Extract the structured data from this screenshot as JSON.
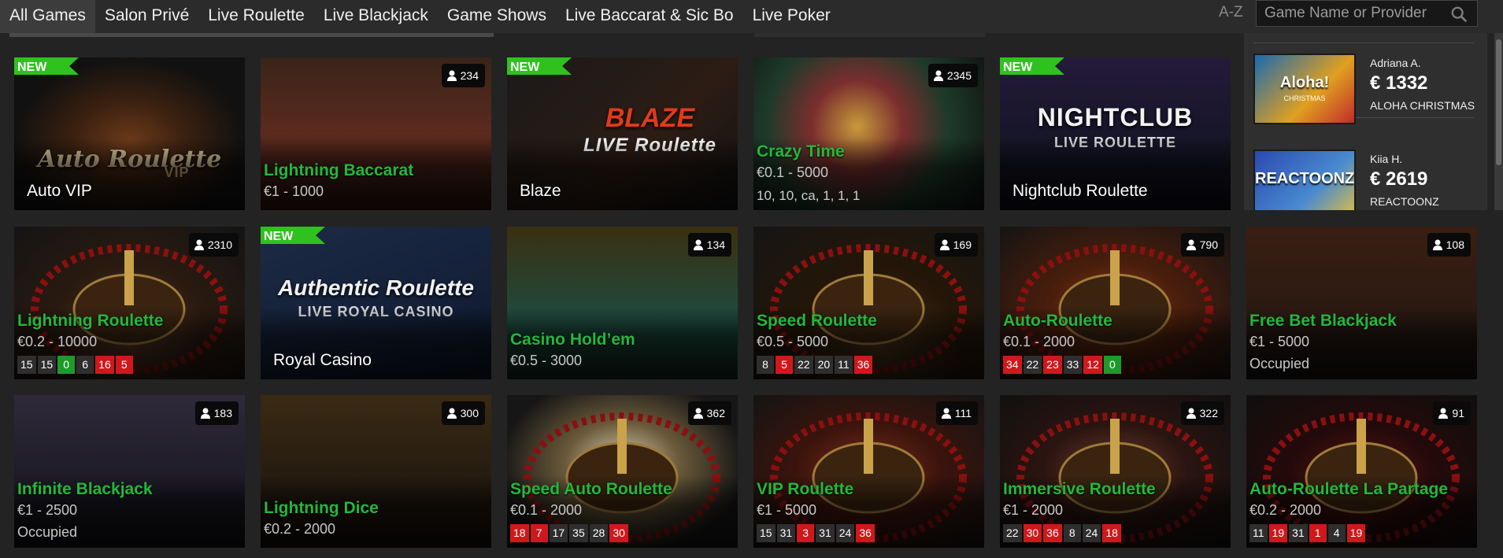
{
  "nav": {
    "tabs": [
      "All Games",
      "Salon Privé",
      "Live Roulette",
      "Live Blackjack",
      "Game Shows",
      "Live Baccarat & Sic Bo",
      "Live Poker"
    ],
    "active_tab": "All Games",
    "sort_label": "A-Z",
    "search_placeholder": "Game Name or Provider"
  },
  "new_label": "NEW",
  "games": [
    {
      "name": "Auto VIP",
      "label_style": "white",
      "art_text": "Auto Roulette",
      "art_sub": "VIP",
      "is_new": true
    },
    {
      "name": "Lightning Baccarat",
      "limit": "€1 - 1000",
      "players": "234"
    },
    {
      "name": "Blaze",
      "label_style": "white",
      "art_text": "BLAZE",
      "art_sub": "LIVE Roulette",
      "is_new": true
    },
    {
      "name": "Crazy Time",
      "limit": "€0.1 - 5000",
      "players": "2345",
      "values": "10, 10, ca, 1, 1, 1"
    },
    {
      "name": "Nightclub Roulette",
      "label_style": "white",
      "art_text": "NIGHTCLUB",
      "art_sub": "LIVE ROULETTE",
      "is_new": true
    },
    {
      "name": "Lightning Roulette",
      "limit": "€0.2 - 10000",
      "players": "2310",
      "results": [
        {
          "v": "15",
          "c": "dark"
        },
        {
          "v": "15",
          "c": "dark"
        },
        {
          "v": "0",
          "c": "green"
        },
        {
          "v": "6",
          "c": "dark"
        },
        {
          "v": "16",
          "c": "red"
        },
        {
          "v": "5",
          "c": "red"
        }
      ]
    },
    {
      "name": "Royal Casino",
      "label_style": "white",
      "art_text": "Authentic Roulette",
      "art_sub": "LIVE ROYAL CASINO",
      "is_new": true
    },
    {
      "name": "Casino Hold’em",
      "limit": "€0.5 - 3000",
      "players": "134"
    },
    {
      "name": "Speed Roulette",
      "limit": "€0.5 - 5000",
      "players": "169",
      "results": [
        {
          "v": "8",
          "c": "dark"
        },
        {
          "v": "5",
          "c": "red"
        },
        {
          "v": "22",
          "c": "dark"
        },
        {
          "v": "20",
          "c": "dark"
        },
        {
          "v": "11",
          "c": "dark"
        },
        {
          "v": "36",
          "c": "red"
        }
      ]
    },
    {
      "name": "Auto-Roulette",
      "limit": "€0.1 - 2000",
      "players": "790",
      "results": [
        {
          "v": "34",
          "c": "red"
        },
        {
          "v": "22",
          "c": "dark"
        },
        {
          "v": "23",
          "c": "red"
        },
        {
          "v": "33",
          "c": "dark"
        },
        {
          "v": "12",
          "c": "red"
        },
        {
          "v": "0",
          "c": "green"
        }
      ]
    },
    {
      "name": "Free Bet Blackjack",
      "limit": "€1 - 5000",
      "players": "108",
      "status": "Occupied"
    },
    {
      "name": "Infinite Blackjack",
      "limit": "€1 - 2500",
      "players": "183",
      "status": "Occupied"
    },
    {
      "name": "Lightning Dice",
      "limit": "€0.2 - 2000",
      "players": "300"
    },
    {
      "name": "Speed Auto Roulette",
      "limit": "€0.1 - 2000",
      "players": "362",
      "results": [
        {
          "v": "18",
          "c": "red"
        },
        {
          "v": "7",
          "c": "red"
        },
        {
          "v": "17",
          "c": "dark"
        },
        {
          "v": "35",
          "c": "dark"
        },
        {
          "v": "28",
          "c": "dark"
        },
        {
          "v": "30",
          "c": "red"
        }
      ]
    },
    {
      "name": "VIP Roulette",
      "limit": "€1 - 5000",
      "players": "111",
      "results": [
        {
          "v": "15",
          "c": "dark"
        },
        {
          "v": "31",
          "c": "dark"
        },
        {
          "v": "3",
          "c": "red"
        },
        {
          "v": "31",
          "c": "dark"
        },
        {
          "v": "24",
          "c": "dark"
        },
        {
          "v": "36",
          "c": "red"
        }
      ]
    },
    {
      "name": "Immersive Roulette",
      "limit": "€1 - 2000",
      "players": "322",
      "results": [
        {
          "v": "22",
          "c": "dark"
        },
        {
          "v": "30",
          "c": "red"
        },
        {
          "v": "36",
          "c": "red"
        },
        {
          "v": "8",
          "c": "dark"
        },
        {
          "v": "24",
          "c": "dark"
        },
        {
          "v": "18",
          "c": "red"
        }
      ]
    },
    {
      "name": "Auto-Roulette La Partage",
      "limit": "€0.2 - 2000",
      "players": "91",
      "results": [
        {
          "v": "11",
          "c": "dark"
        },
        {
          "v": "19",
          "c": "red"
        },
        {
          "v": "31",
          "c": "dark"
        },
        {
          "v": "1",
          "c": "red"
        },
        {
          "v": "4",
          "c": "dark"
        },
        {
          "v": "19",
          "c": "red"
        }
      ]
    }
  ],
  "winners": [
    {
      "player": "Adriana A.",
      "amount": "€ 1332",
      "game": "ALOHA CHRISTMAS",
      "thumb_text": "Aloha!",
      "thumb_sub": "CHRISTMAS"
    },
    {
      "player": "Kiia H.",
      "amount": "€ 2619",
      "game": "REACTOONZ",
      "thumb_text": "REACTOONZ"
    }
  ],
  "colors": {
    "accent_green": "#22b93a",
    "result_red": "#d0181c",
    "result_green": "#1c9b2a",
    "background": "#232323"
  }
}
